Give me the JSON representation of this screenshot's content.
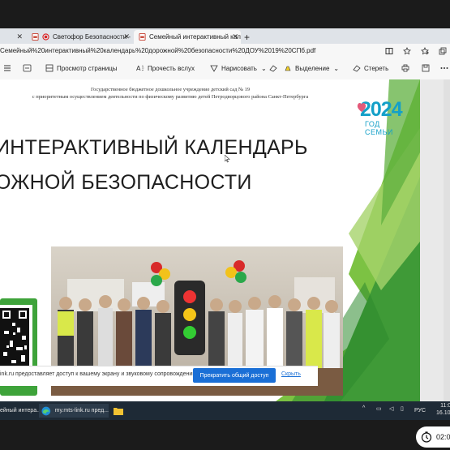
{
  "browser": {
    "tabs": [
      {
        "label": "",
        "partial": true
      },
      {
        "label": "Светофор Безопасности -",
        "icon": "pdf-icon"
      },
      {
        "label": "Семейный интерактивный кал",
        "icon": "pdf-icon",
        "active": true
      }
    ],
    "url": "Семейный%20интерактивный%20календарь%20дорожной%20безопасности%20ДОУ%2019%20СПб.pdf"
  },
  "pdf_toolbar": {
    "page_view": "Просмотр страницы",
    "read_aloud": "Прочесть вслух",
    "draw": "Нарисовать",
    "highlight": "Выделение",
    "erase": "Стереть"
  },
  "slide": {
    "header_line1": "Государственное бюджетное дошкольное учреждение детский сад № 19",
    "header_line2": "с приоритетным осуществлением деятельности по физическому развитию детей Петродворцового района Санкт-Петербурга",
    "title_line1": "ИНТЕРАКТИВНЫЙ КАЛЕНДАРЬ",
    "title_line2": "ОЖНОЙ БЕЗОПАСНОСТИ",
    "logo_year": "2024",
    "logo_text": "ГОД СЕМЬИ"
  },
  "share_bar": {
    "message": "ink.ru предоставляет доступ к вашему экрану и звуковому сопровождению.",
    "stop_button": "Прекратить общий доступ",
    "hide_link": "Скрыть"
  },
  "taskbar": {
    "item1": "ейный интера...",
    "item2": "my.mts-link.ru пред...",
    "lang": "РУС",
    "time": "11:02",
    "date": "16.10.20"
  },
  "overlay_clock": "02:0",
  "colors": {
    "accent_green": "#3ea33a",
    "logo_blue": "#14a0c8",
    "share_blue": "#1a6fd6"
  }
}
